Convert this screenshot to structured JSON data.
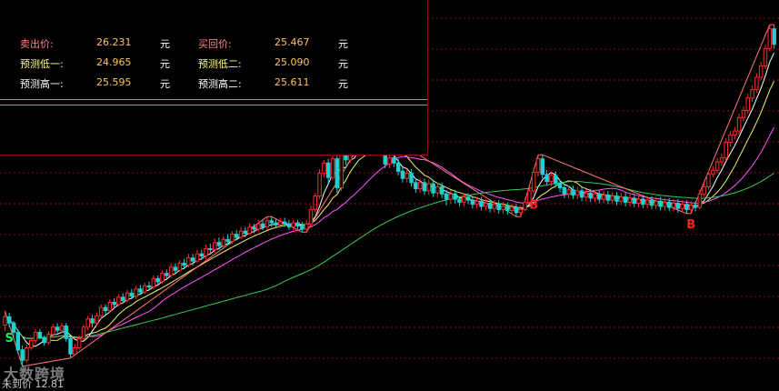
{
  "panel": {
    "rows": [
      {
        "l1": "卖出价:",
        "v1": "26.231",
        "u1": "元",
        "l2": "买回价:",
        "v2": "25.467",
        "u2": "元"
      },
      {
        "l1": "预测低一:",
        "v1": "24.965",
        "u1": "元",
        "l2": "预测低二:",
        "v2": "25.090",
        "u2": "元"
      },
      {
        "l1": "预测高一:",
        "v1": "25.595",
        "u1": "元",
        "l2": "预测高二:",
        "v2": "25.611",
        "u2": "元"
      }
    ]
  },
  "watermark": "大数跨境",
  "last_label": "未到价 12.81",
  "colors": {
    "up": "#ff2a2a",
    "down": "#20d0d0",
    "flat": "#ffffff",
    "ma5": "#ffffff",
    "ma10": "#f2f26a",
    "ma20": "#ff55ff",
    "ma60": "#33cc55",
    "zigzag": "#ff7777",
    "buy": "#ff2222",
    "sell": "#22ee44",
    "grid": "#8a1010"
  },
  "chart_data": {
    "type": "candlestick",
    "y_range": [
      -2,
      32
    ],
    "signals": [
      {
        "index": 1,
        "label": "S",
        "type": "sell"
      },
      {
        "index": 121,
        "label": "B",
        "type": "buy"
      },
      {
        "index": 157,
        "label": "B",
        "type": "buy"
      }
    ],
    "candles": [
      [
        2.8,
        3.6,
        2.2,
        4.2
      ],
      [
        3.6,
        3.0,
        2.6,
        4.0
      ],
      [
        3.0,
        2.1,
        1.4,
        3.2
      ],
      [
        2.1,
        0.4,
        0.0,
        2.4
      ],
      [
        0.4,
        -0.6,
        -1.2,
        0.8
      ],
      [
        -0.6,
        0.6,
        -0.8,
        0.9
      ],
      [
        0.6,
        1.3,
        0.4,
        1.6
      ],
      [
        1.3,
        2.1,
        1.0,
        2.4
      ],
      [
        2.1,
        1.6,
        1.4,
        2.4
      ],
      [
        1.6,
        1.1,
        0.8,
        1.8
      ],
      [
        1.1,
        1.9,
        0.9,
        2.2
      ],
      [
        1.9,
        2.6,
        1.6,
        2.9
      ],
      [
        2.6,
        2.3,
        2.0,
        3.0
      ],
      [
        2.3,
        2.7,
        2.0,
        3.0
      ],
      [
        2.7,
        1.5,
        1.2,
        3.0
      ],
      [
        1.5,
        0.0,
        -0.4,
        1.7
      ],
      [
        0.0,
        0.6,
        -0.2,
        1.0
      ],
      [
        0.6,
        1.5,
        0.4,
        1.8
      ],
      [
        1.5,
        2.6,
        1.3,
        2.9
      ],
      [
        2.6,
        3.4,
        2.3,
        3.7
      ],
      [
        3.4,
        3.0,
        2.6,
        3.8
      ],
      [
        3.0,
        3.7,
        2.8,
        4.0
      ],
      [
        3.7,
        4.5,
        3.4,
        4.8
      ],
      [
        4.5,
        4.2,
        3.8,
        4.8
      ],
      [
        4.2,
        5.0,
        4.0,
        5.3
      ],
      [
        5.0,
        4.8,
        4.4,
        5.4
      ],
      [
        4.8,
        5.5,
        4.6,
        5.8
      ],
      [
        5.5,
        5.2,
        4.9,
        5.9
      ],
      [
        5.2,
        5.9,
        5.0,
        6.2
      ],
      [
        5.9,
        5.6,
        5.3,
        6.3
      ],
      [
        5.6,
        6.3,
        5.3,
        6.6
      ],
      [
        6.3,
        6.0,
        5.7,
        6.7
      ],
      [
        6.0,
        6.6,
        5.8,
        6.9
      ],
      [
        6.6,
        6.5,
        6.2,
        7.0
      ],
      [
        6.5,
        7.3,
        6.3,
        7.6
      ],
      [
        7.3,
        7.0,
        6.6,
        7.6
      ],
      [
        7.0,
        7.8,
        6.8,
        8.1
      ],
      [
        7.8,
        7.6,
        7.3,
        8.2
      ],
      [
        7.6,
        8.4,
        7.4,
        8.8
      ],
      [
        8.4,
        8.1,
        7.8,
        8.8
      ],
      [
        8.1,
        8.8,
        7.9,
        9.1
      ],
      [
        8.8,
        8.6,
        8.2,
        9.2
      ],
      [
        8.6,
        9.3,
        8.4,
        9.7
      ],
      [
        9.3,
        9.0,
        8.6,
        9.7
      ],
      [
        9.0,
        9.7,
        8.8,
        10.1
      ],
      [
        9.7,
        9.5,
        9.1,
        10.1
      ],
      [
        9.5,
        10.2,
        9.2,
        10.6
      ],
      [
        10.2,
        10.1,
        9.7,
        10.7
      ],
      [
        10.1,
        10.8,
        9.8,
        11.2
      ],
      [
        10.8,
        10.5,
        10.1,
        11.3
      ],
      [
        10.5,
        11.1,
        10.3,
        11.4
      ],
      [
        11.1,
        10.9,
        10.5,
        11.6
      ],
      [
        10.9,
        11.6,
        10.7,
        11.9
      ],
      [
        11.6,
        11.3,
        11.0,
        12.0
      ],
      [
        11.3,
        11.9,
        11.1,
        12.3
      ],
      [
        11.9,
        11.7,
        11.3,
        12.3
      ],
      [
        11.7,
        12.3,
        11.5,
        12.7
      ],
      [
        12.3,
        12.1,
        11.7,
        12.6
      ],
      [
        12.1,
        12.6,
        11.9,
        13.0
      ],
      [
        12.6,
        12.3,
        12.0,
        13.0
      ],
      [
        12.3,
        12.9,
        12.0,
        13.3
      ],
      [
        12.9,
        12.7,
        12.3,
        13.3
      ],
      [
        12.7,
        12.5,
        12.2,
        13.1
      ],
      [
        12.5,
        12.8,
        12.2,
        13.2
      ],
      [
        12.8,
        12.6,
        12.3,
        13.2
      ],
      [
        12.6,
        12.3,
        12.0,
        13.0
      ],
      [
        12.3,
        12.7,
        12.0,
        13.0
      ],
      [
        12.7,
        12.4,
        12.1,
        13.0
      ],
      [
        12.4,
        12.1,
        11.8,
        12.8
      ],
      [
        12.1,
        12.6,
        11.8,
        13.0
      ],
      [
        12.6,
        14.0,
        12.3,
        14.4
      ],
      [
        14.0,
        15.3,
        13.7,
        15.6
      ],
      [
        15.3,
        17.5,
        15.0,
        17.9
      ],
      [
        17.5,
        18.5,
        17.1,
        18.8
      ],
      [
        18.5,
        17.1,
        16.5,
        18.9
      ],
      [
        17.1,
        18.9,
        16.8,
        19.2
      ],
      [
        18.9,
        16.1,
        15.6,
        19.2
      ],
      [
        16.1,
        19.5,
        15.8,
        19.9
      ],
      [
        19.5,
        18.8,
        18.3,
        19.9
      ],
      [
        18.8,
        20.5,
        18.5,
        20.9
      ],
      [
        20.5,
        20.0,
        19.5,
        20.9
      ],
      [
        20.0,
        21.0,
        19.6,
        21.4
      ],
      [
        21.0,
        20.6,
        20.1,
        21.4
      ],
      [
        20.6,
        21.7,
        20.2,
        22.0
      ],
      [
        21.7,
        21.0,
        20.6,
        22.2
      ],
      [
        21.0,
        20.6,
        20.2,
        21.4
      ],
      [
        20.6,
        19.7,
        19.3,
        21.0
      ],
      [
        19.7,
        18.4,
        18.0,
        20.1
      ],
      [
        18.4,
        19.0,
        18.0,
        19.4
      ],
      [
        19.0,
        18.5,
        18.1,
        19.4
      ],
      [
        18.5,
        17.7,
        17.3,
        18.9
      ],
      [
        17.7,
        17.0,
        16.6,
        18.1
      ],
      [
        17.0,
        17.5,
        16.6,
        17.9
      ],
      [
        17.5,
        16.6,
        16.2,
        17.9
      ],
      [
        16.6,
        16.0,
        15.6,
        17.0
      ],
      [
        16.0,
        16.6,
        15.6,
        17.0
      ],
      [
        16.6,
        15.8,
        15.4,
        17.0
      ],
      [
        15.8,
        16.5,
        15.4,
        16.9
      ],
      [
        16.5,
        15.6,
        15.2,
        16.9
      ],
      [
        15.6,
        16.2,
        15.2,
        16.6
      ],
      [
        16.2,
        15.5,
        15.1,
        16.6
      ],
      [
        15.5,
        15.0,
        14.4,
        15.9
      ],
      [
        15.0,
        15.5,
        14.6,
        15.9
      ],
      [
        15.5,
        15.0,
        14.6,
        15.9
      ],
      [
        15.0,
        14.7,
        14.3,
        15.3
      ],
      [
        14.7,
        15.2,
        14.3,
        15.6
      ],
      [
        15.2,
        14.9,
        14.5,
        15.6
      ],
      [
        14.9,
        14.5,
        14.1,
        15.3
      ],
      [
        14.5,
        14.8,
        14.1,
        15.2
      ],
      [
        14.8,
        14.3,
        13.9,
        15.2
      ],
      [
        14.3,
        14.6,
        13.9,
        15.0
      ],
      [
        14.6,
        14.1,
        13.7,
        15.0
      ],
      [
        14.1,
        14.5,
        13.7,
        14.9
      ],
      [
        14.5,
        14.0,
        13.6,
        14.9
      ],
      [
        14.0,
        14.3,
        13.6,
        14.7
      ],
      [
        14.3,
        13.9,
        13.5,
        14.7
      ],
      [
        13.9,
        14.2,
        13.5,
        14.6
      ],
      [
        14.2,
        13.7,
        13.3,
        14.6
      ],
      [
        13.7,
        14.0,
        13.3,
        14.4
      ],
      [
        14.0,
        14.7,
        13.8,
        15.1
      ],
      [
        14.7,
        15.8,
        14.5,
        16.2
      ],
      [
        15.8,
        17.6,
        15.5,
        18.0
      ],
      [
        17.6,
        18.9,
        17.2,
        19.3
      ],
      [
        18.9,
        17.4,
        17.0,
        19.3
      ],
      [
        17.4,
        16.7,
        16.3,
        17.8
      ],
      [
        16.7,
        17.3,
        16.3,
        17.7
      ],
      [
        17.3,
        16.5,
        16.1,
        17.7
      ],
      [
        16.5,
        16.1,
        15.7,
        16.9
      ],
      [
        16.1,
        15.5,
        15.1,
        16.5
      ],
      [
        15.5,
        15.9,
        15.1,
        16.3
      ],
      [
        15.9,
        15.4,
        15.0,
        16.3
      ],
      [
        15.4,
        15.8,
        15.0,
        16.2
      ],
      [
        15.8,
        15.2,
        14.8,
        16.2
      ],
      [
        15.2,
        15.6,
        14.8,
        16.0
      ],
      [
        15.6,
        15.1,
        14.7,
        16.0
      ],
      [
        15.1,
        15.5,
        14.7,
        15.9
      ],
      [
        15.5,
        15.0,
        14.6,
        15.9
      ],
      [
        15.0,
        15.4,
        14.6,
        15.8
      ],
      [
        15.4,
        14.9,
        14.5,
        15.8
      ],
      [
        14.9,
        15.3,
        14.5,
        15.7
      ],
      [
        15.3,
        14.8,
        14.4,
        15.7
      ],
      [
        14.8,
        15.2,
        14.4,
        15.6
      ],
      [
        15.2,
        14.7,
        14.3,
        15.6
      ],
      [
        14.7,
        15.1,
        14.3,
        15.5
      ],
      [
        15.1,
        14.6,
        14.2,
        15.5
      ],
      [
        14.6,
        15.0,
        14.2,
        15.4
      ],
      [
        15.0,
        14.5,
        14.1,
        15.4
      ],
      [
        14.5,
        14.9,
        14.1,
        15.3
      ],
      [
        14.9,
        14.4,
        14.0,
        15.3
      ],
      [
        14.4,
        14.8,
        14.0,
        15.2
      ],
      [
        14.8,
        14.3,
        13.9,
        15.2
      ],
      [
        14.3,
        14.7,
        13.9,
        15.1
      ],
      [
        14.7,
        14.2,
        13.8,
        15.1
      ],
      [
        14.2,
        14.6,
        13.8,
        15.0
      ],
      [
        14.6,
        14.1,
        13.7,
        15.0
      ],
      [
        14.1,
        14.5,
        13.7,
        14.9
      ],
      [
        14.5,
        14.0,
        13.6,
        14.9
      ],
      [
        14.0,
        14.4,
        13.6,
        14.8
      ],
      [
        14.4,
        14.2,
        13.8,
        14.8
      ],
      [
        14.2,
        15.5,
        14.0,
        15.9
      ],
      [
        15.5,
        16.2,
        15.2,
        16.6
      ],
      [
        16.2,
        17.4,
        15.9,
        17.8
      ],
      [
        17.4,
        17.8,
        17.1,
        18.2
      ],
      [
        17.8,
        18.6,
        17.5,
        19.0
      ],
      [
        18.6,
        19.0,
        18.2,
        19.4
      ],
      [
        19.0,
        20.5,
        18.7,
        20.9
      ],
      [
        20.5,
        21.2,
        20.1,
        21.6
      ],
      [
        21.2,
        21.6,
        20.8,
        22.0
      ],
      [
        21.6,
        22.9,
        21.3,
        23.3
      ],
      [
        22.9,
        23.6,
        22.5,
        24.0
      ],
      [
        23.6,
        24.8,
        23.3,
        25.2
      ],
      [
        24.8,
        25.6,
        24.4,
        26.0
      ],
      [
        25.6,
        26.8,
        25.3,
        27.2
      ],
      [
        26.8,
        27.9,
        26.5,
        28.3
      ],
      [
        27.9,
        29.6,
        27.6,
        30.0
      ],
      [
        29.6,
        31.5,
        29.3,
        31.9
      ],
      [
        31.5,
        30.0,
        29.6,
        31.9
      ]
    ]
  }
}
